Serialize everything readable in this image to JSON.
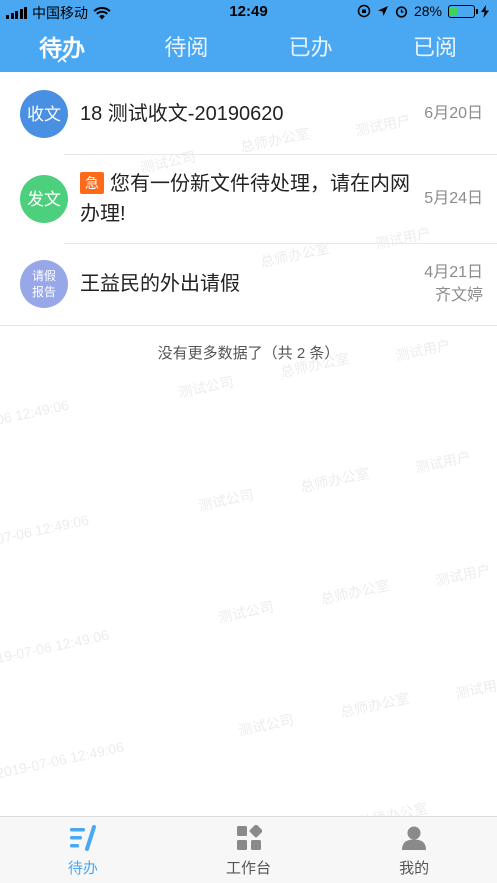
{
  "status_bar": {
    "carrier": "中国移动",
    "time": "12:49",
    "battery_percent": "28%"
  },
  "tabs": [
    {
      "label": "待办",
      "active": true
    },
    {
      "label": "待阅",
      "active": false
    },
    {
      "label": "已办",
      "active": false
    },
    {
      "label": "已阅",
      "active": false
    }
  ],
  "list": {
    "items": [
      {
        "avatar": "收文",
        "avatar_color": "#4a90e2",
        "title": "18 测试收文-20190620",
        "date": "6月20日"
      },
      {
        "avatar": "发文",
        "avatar_color": "#4cd07d",
        "urgent_badge": "急",
        "title": "您有一份新文件待处理，请在内网办理!",
        "date": "5月24日"
      },
      {
        "avatar_line1": "请假",
        "avatar_line2": "报告",
        "avatar_color": "#98a7e8",
        "title": "王益民的外出请假",
        "date": "4月21日",
        "sender": "齐文婷"
      }
    ],
    "footer": "没有更多数据了（共 2 条）"
  },
  "watermark": {
    "texts": [
      "测试用户",
      "总师办公室",
      "测试公司",
      "2019-07-06 12:49:06"
    ]
  },
  "bottom_nav": [
    {
      "label": "待办",
      "icon": "todo-list-icon",
      "active": true
    },
    {
      "label": "工作台",
      "icon": "workbench-grid-icon",
      "active": false
    },
    {
      "label": "我的",
      "icon": "user-profile-icon",
      "active": false
    }
  ],
  "colors": {
    "accent": "#4aa8f3",
    "urgent": "#ff6a1a"
  }
}
